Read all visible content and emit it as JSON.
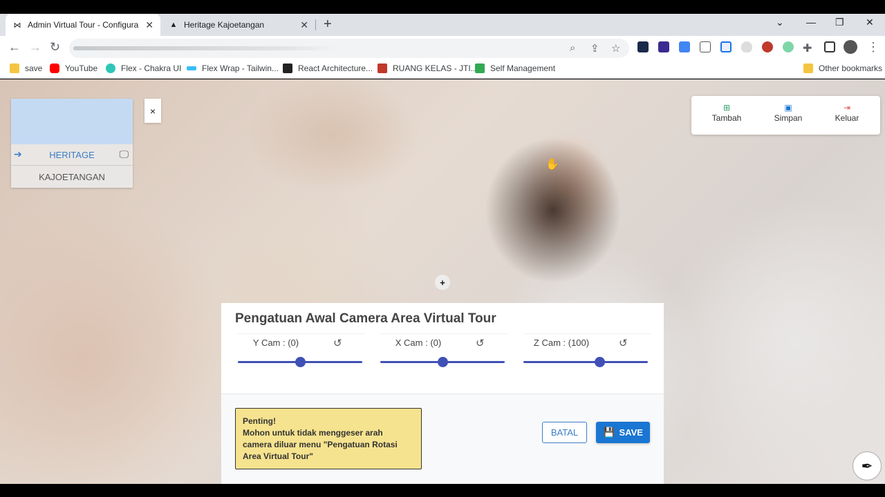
{
  "browser": {
    "tabs": [
      {
        "title": "Admin Virtual Tour - Configurato",
        "favicon": "bowtie-icon",
        "active": true
      },
      {
        "title": "Heritage Kajoetangan",
        "favicon": "triangle-icon",
        "active": false
      }
    ],
    "bookmarks": [
      {
        "label": "save",
        "icon": "folder-icon",
        "color": "#f5c542"
      },
      {
        "label": "YouTube",
        "icon": "youtube-icon",
        "color": "#ff0000"
      },
      {
        "label": "Flex - Chakra UI",
        "icon": "chakra-icon",
        "color": "#2fc6b8"
      },
      {
        "label": "Flex Wrap - Tailwin...",
        "icon": "tailwind-icon",
        "color": "#38bdf8"
      },
      {
        "label": "React Architecture...",
        "icon": "react-arch-icon",
        "color": "#222222"
      },
      {
        "label": "RUANG KELAS - JTI...",
        "icon": "ruang-kelas-icon",
        "color": "#c0392b"
      },
      {
        "label": "Self Management",
        "icon": "self-management-icon",
        "color": "#34a853"
      }
    ],
    "other_bookmarks": "Other bookmarks"
  },
  "viewpoints": {
    "items": [
      {
        "label": "HERITAGE",
        "active": true
      },
      {
        "label": "KAJOETANGAN",
        "active": false
      }
    ],
    "close_glyph": "×"
  },
  "action_menu": {
    "tambah": "Tambah",
    "simpan": "Simpan",
    "keluar": "Keluar"
  },
  "camera_dialog": {
    "title": "Pengatuan Awal Camera Area Virtual Tour",
    "sliders": [
      {
        "label": "Y Cam : (0)",
        "value": 0,
        "min": -180,
        "max": 180,
        "fill": 0.5
      },
      {
        "label": "X Cam : (0)",
        "value": 0,
        "min": -180,
        "max": 180,
        "fill": 0.5
      },
      {
        "label": "Z Cam : (100)",
        "value": 100,
        "min": -180,
        "max": 180,
        "fill": 0.61
      }
    ],
    "warning_title": "Penting!",
    "warning_text": "Mohon untuk tidak menggeser arah camera diluar menu \"Pengatuan Rotasi Area Virtual Tour\"",
    "cancel_label": "BATAL",
    "save_label": "SAVE"
  },
  "colors": {
    "accent": "#1976d2",
    "slider": "#3f51b5",
    "warning_bg": "#f6e38f",
    "tambah": "#2e9e6b",
    "simpan": "#1976d2",
    "keluar": "#d9534f"
  }
}
